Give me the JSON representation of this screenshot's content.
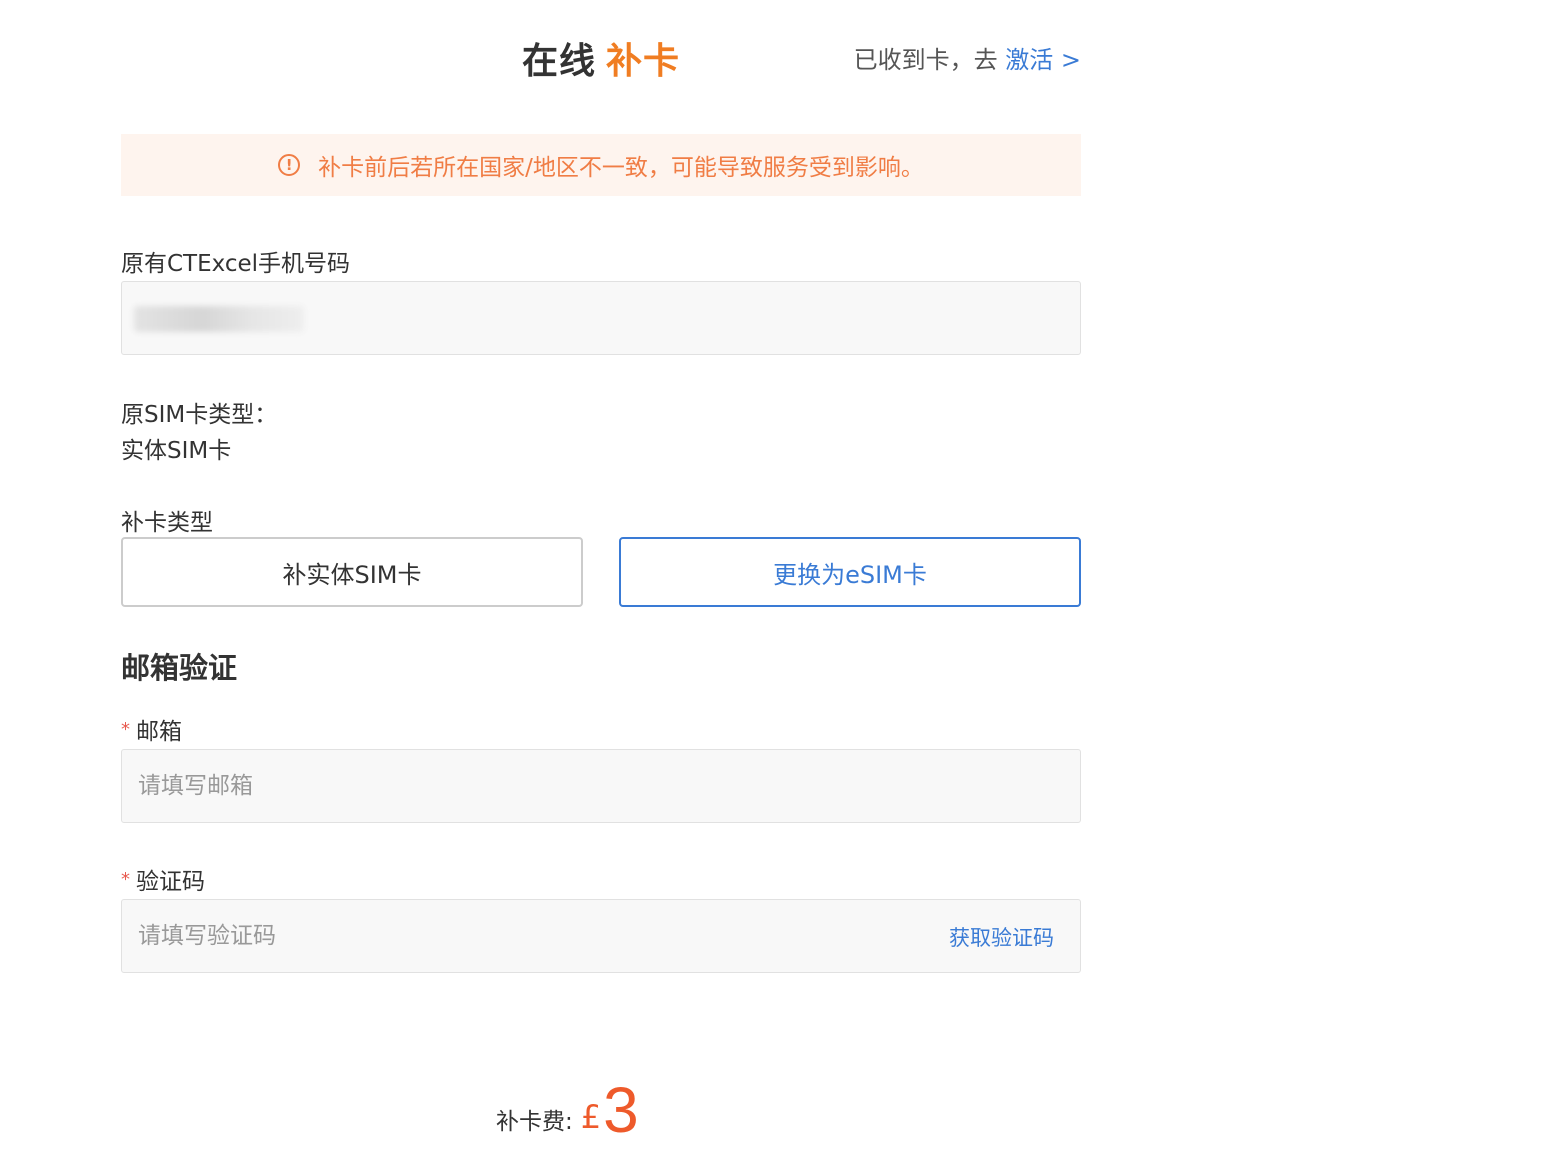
{
  "header": {
    "title_main": "在线",
    "title_accent": "补卡",
    "activate_prefix": "已收到卡，去",
    "activate_link": "激活 >"
  },
  "notice": {
    "icon": "alert-circle-icon",
    "text": "补卡前后若所在国家/地区不一致，可能导致服务受到影响。"
  },
  "phone": {
    "label": "原有CTExcel手机号码",
    "value": ""
  },
  "sim_type": {
    "label": "原SIM卡类型：",
    "value": "实体SIM卡"
  },
  "replace_type": {
    "label": "补卡类型",
    "options": [
      "补实体SIM卡",
      "更换为eSIM卡"
    ],
    "selected": "更换为eSIM卡"
  },
  "email_section": {
    "title": "邮箱验证",
    "email_label": "邮箱",
    "email_placeholder": "请填写邮箱",
    "code_label": "验证码",
    "code_placeholder": "请填写验证码",
    "get_code": "获取验证码",
    "required_mark": "*"
  },
  "fee": {
    "label": "补卡费:",
    "currency": "£",
    "amount": "3"
  },
  "colors": {
    "accent_orange": "#f07d22",
    "link_blue": "#3a7bd5",
    "notice_bg": "#fef4ee",
    "price_red": "#ee5a2b"
  }
}
